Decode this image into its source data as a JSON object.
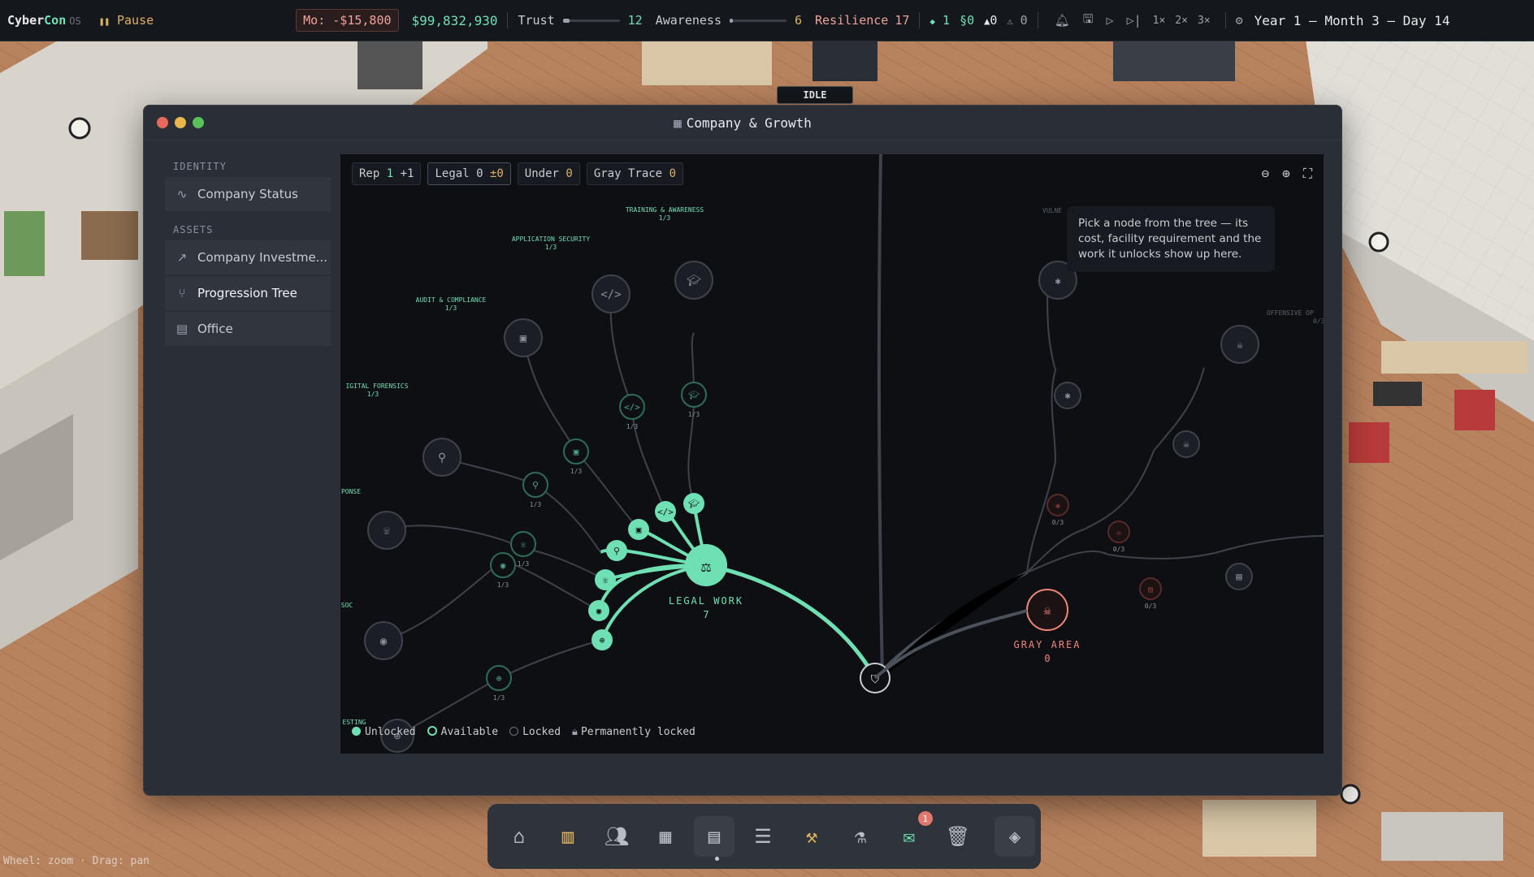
{
  "topbar": {
    "brand_a": "Cyber",
    "brand_b": "Con",
    "brand_os": "OS",
    "pause_label": "Pause",
    "monthly": "Mo: -$15,800",
    "cash": "$99,832,930",
    "trust_label": "Trust",
    "trust_value": "12",
    "trust_level": 0.12,
    "awareness_label": "Awareness",
    "awareness_value": "6",
    "awareness_level": 0.06,
    "resilience_label": "Resilience",
    "resilience_value": "17",
    "stat1": "1",
    "stat2": "0",
    "stat3": "0",
    "stat4": "0",
    "speed": [
      "1×",
      "2×",
      "3×"
    ],
    "date": "Year 1 — Month 3 — Day 14"
  },
  "office": {
    "idle_label": "IDLE",
    "footer_hint": "Wheel: zoom · Drag: pan"
  },
  "window": {
    "title": "Company & Growth",
    "title_icon": "building-icon"
  },
  "sidebar": {
    "identity_label": "IDENTITY",
    "assets_label": "ASSETS",
    "items": [
      {
        "label": "Company Status",
        "icon": "pulse-icon"
      },
      {
        "label": "Company Investme...",
        "icon": "trend-icon"
      },
      {
        "label": "Progression Tree",
        "icon": "branch-icon"
      },
      {
        "label": "Office",
        "icon": "building-icon"
      }
    ]
  },
  "chips": {
    "rep_label": "Rep",
    "rep_value": "1",
    "rep_delta": "+1",
    "legal_label": "Legal",
    "legal_value": "0",
    "legal_delta": "±0",
    "under_label": "Under",
    "under_value": "0",
    "gray_label": "Gray Trace",
    "gray_value": "0"
  },
  "hint": "Pick a node from the tree — its cost, facility requirement and the work it unlocks show up here.",
  "tree": {
    "legal_label": "LEGAL WORK",
    "legal_value": "7",
    "gray_label": "GRAY AREA",
    "gray_value": "0",
    "branch_labels": [
      {
        "text": "TRAINING & AWARENESS",
        "sub": "1/3"
      },
      {
        "text": "APPLICATION SECURITY",
        "sub": "1/3"
      },
      {
        "text": "AUDIT & COMPLIANCE",
        "sub": "1/3"
      },
      {
        "text": "IGITAL FORENSICS",
        "sub": "1/3"
      },
      {
        "text": "PONSE",
        "sub": ""
      },
      {
        "text": "SOC",
        "sub": ""
      },
      {
        "text": "ESTING",
        "sub": ""
      },
      {
        "text": "VULNE",
        "sub": ""
      },
      {
        "text": "OFFENSIVE OP",
        "sub": "0/3"
      }
    ],
    "counts_legal": [
      "1/3",
      "1/3",
      "1/3",
      "1/3",
      "1/3",
      "1/3",
      "1/3"
    ],
    "counts_gray": [
      "0/3",
      "0/3",
      "0/3"
    ]
  },
  "legend": {
    "unlocked": "Unlocked",
    "available": "Available",
    "locked": "Locked",
    "perm": "Permanently locked"
  },
  "dock": {
    "badge": "1",
    "icons": [
      "shop-icon",
      "board-icon",
      "people-icon",
      "calculator-icon",
      "building-icon",
      "server-icon",
      "hammer-icon",
      "flask-icon",
      "mail-icon",
      "trash-icon",
      "layers-icon"
    ]
  },
  "colors": {
    "accent": "#6fe0b3",
    "danger": "#f0857a",
    "warning": "#e0b15e"
  }
}
